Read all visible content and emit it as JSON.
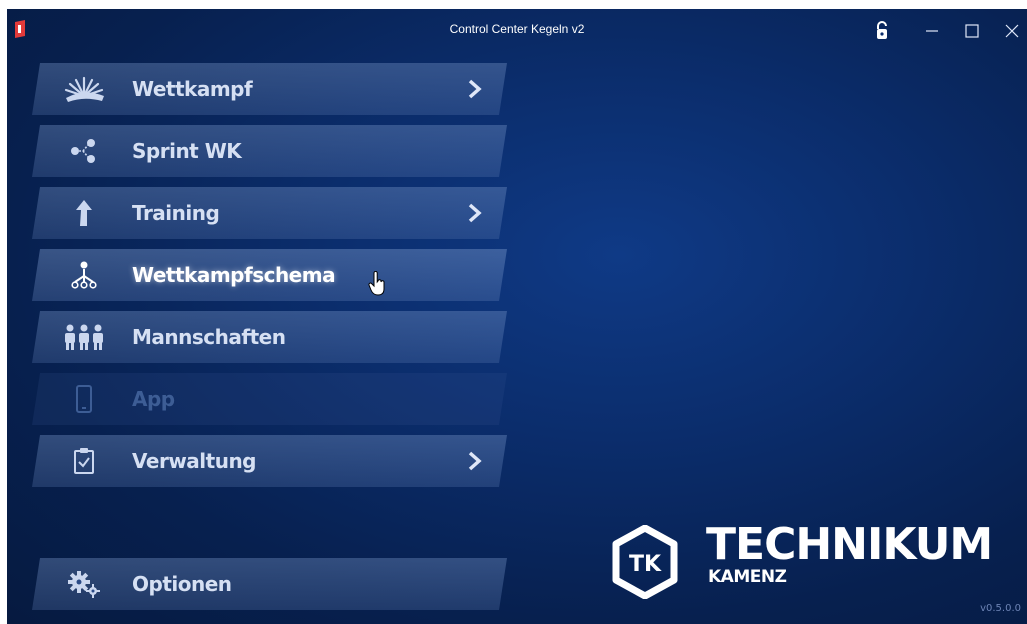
{
  "window": {
    "title": "Control Center Kegeln v2"
  },
  "titlebar": {
    "lock_icon": "lock-open-icon",
    "min_icon": "minimize-icon",
    "max_icon": "maximize-icon",
    "close_icon": "close-icon"
  },
  "menu": {
    "items": [
      {
        "label": "Wettkampf",
        "icon": "fan-icon",
        "has_submenu": true,
        "state": "normal"
      },
      {
        "label": "Sprint WK",
        "icon": "share-icon",
        "has_submenu": false,
        "state": "normal"
      },
      {
        "label": "Training",
        "icon": "arrow-up-icon",
        "has_submenu": true,
        "state": "normal"
      },
      {
        "label": "Wettkampfschema",
        "icon": "hierarchy-icon",
        "has_submenu": false,
        "state": "hover"
      },
      {
        "label": "Mannschaften",
        "icon": "team-icon",
        "has_submenu": false,
        "state": "normal"
      },
      {
        "label": "App",
        "icon": "phone-icon",
        "has_submenu": false,
        "state": "disabled"
      },
      {
        "label": "Verwaltung",
        "icon": "clipboard-check-icon",
        "has_submenu": true,
        "state": "normal"
      }
    ],
    "options": {
      "label": "Optionen",
      "icon": "gears-icon"
    }
  },
  "logo": {
    "badge": "TK",
    "name": "TECHNIKUM",
    "sub": "KAMENZ"
  },
  "version": "v0.5.0.0",
  "colors": {
    "bg": "#0b2d6c",
    "accent": "#ffffff",
    "disabled": "#3d5d95"
  }
}
